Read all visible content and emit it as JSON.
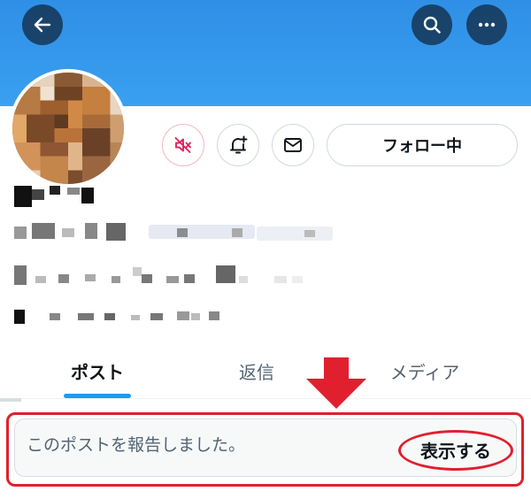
{
  "header": {
    "back_icon": "arrow-left-icon",
    "search_icon": "search-icon",
    "more_icon": "more-dots-icon",
    "banner_color": "#3a9ff0"
  },
  "profile": {
    "avatar_icon": "pixelated-avatar",
    "mute_icon": "muted-speaker-icon",
    "notify_icon": "bell-plus-icon",
    "message_icon": "envelope-icon",
    "follow_label": "フォロー中"
  },
  "tabs": [
    {
      "label": "ポスト",
      "active": true
    },
    {
      "label": "返信",
      "active": false
    },
    {
      "label": "メディア",
      "active": false
    }
  ],
  "notice": {
    "text": "このポストを報告しました。",
    "show_label": "表示する"
  },
  "annotation": {
    "color": "#e0202e",
    "arrow_icon": "down-arrow-annotation"
  }
}
